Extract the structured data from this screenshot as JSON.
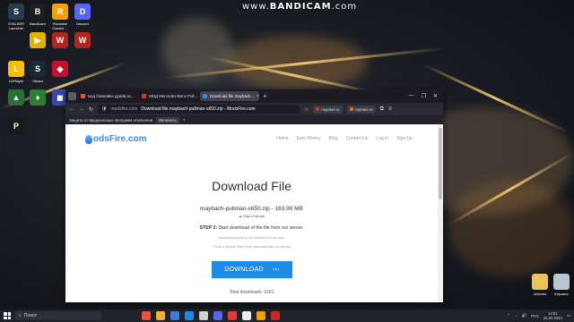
{
  "watermark": {
    "prefix": "www.",
    "brand": "BANDICAM",
    "suffix": ".com"
  },
  "desktop_left": [
    {
      "label": "STALKER Launcher",
      "color": "#2c3a4f",
      "glyph": "S"
    },
    {
      "label": "Bandicam",
      "color": "#1e1e1e",
      "glyph": "B"
    },
    {
      "label": "Rockstar Games ...",
      "color": "#f4a100",
      "glyph": "R"
    },
    {
      "label": "Discord",
      "color": "#5865f2",
      "glyph": "D"
    },
    {
      "label": "",
      "color": "#e0b400",
      "glyph": "▶"
    },
    {
      "label": "",
      "color": "#b0261e",
      "glyph": "W"
    },
    {
      "label": "",
      "color": "#b0261e",
      "glyph": "W"
    },
    {
      "label": "LDPlayer",
      "color": "#f5c000",
      "glyph": "L"
    },
    {
      "label": "Steam",
      "color": "#1b2838",
      "glyph": "S"
    },
    {
      "label": "",
      "color": "#c8102e",
      "glyph": "◆"
    },
    {
      "label": "",
      "color": "#2a6f3b",
      "glyph": "▲"
    },
    {
      "label": "",
      "color": "#2e7d32",
      "glyph": "♦"
    },
    {
      "label": "",
      "color": "#3949ab",
      "glyph": "◼"
    },
    {
      "label": "",
      "color": "#1a1a1a",
      "glyph": "P"
    }
  ],
  "browser": {
    "tabs": [
      {
        "label": "мод ближайки драйв из...",
        "color": "#e8533a",
        "active": false
      },
      {
        "label": "МОД Mercedes-Benz Pull...",
        "color": "#d23a2a",
        "active": false
      },
      {
        "label": "Download file maybach...",
        "color": "#2d8ee8",
        "active": true
      }
    ],
    "url_domain": "modsfire.com",
    "url_title": "Download file maybach-pullman-s650.zip - ModsFire.com",
    "ext_translate": "перевести",
    "ext_translate2": "перевести",
    "infobar_text": "Защита от вредоносных программ отключена",
    "infobar_toggle": "Включить"
  },
  "site": {
    "logo": "odsFire.com",
    "nav": [
      "Home",
      "Earn Money",
      "Blog",
      "Contact Us",
      "Log In",
      "Sign Up"
    ],
    "heading": "Download File",
    "file_line": "maybach-pullman-s650.zip - 163.99 MB",
    "report": "Report abuse",
    "step_label": "STEP 2:",
    "step_text": " Start download of the file from our server.",
    "note1": "Download speed is not limited from our side",
    "note2": "*Click a second time if the download has not started",
    "download_label": "DOWNLOAD",
    "download_arrows": "›››",
    "total": "Total downloads: 1691"
  },
  "desktop_right": [
    {
      "label": "vehicles",
      "color": "#e7c35a"
    },
    {
      "label": "Корзина",
      "color": "#b9c5cf"
    }
  ],
  "taskbar": {
    "search_placeholder": "Поиск",
    "apps": [
      "#e8533a",
      "#f2b134",
      "#3d7be0",
      "#1e88e5",
      "#d0d0d0",
      "#5865f2",
      "#e53935",
      "#eeeeee",
      "#f4a100",
      "#c62828"
    ],
    "lang": "РУС",
    "time": "14:01",
    "date": "25.02.2024"
  }
}
